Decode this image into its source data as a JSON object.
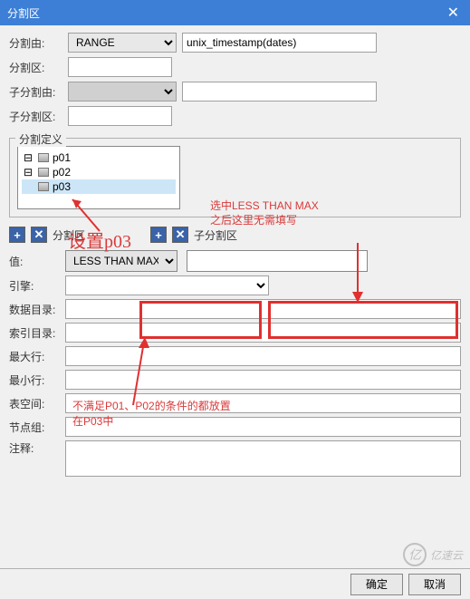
{
  "titlebar": {
    "title": "分割区"
  },
  "form": {
    "partition_by_label": "分割由:",
    "partition_by_value": "RANGE",
    "partition_by_expr": "unix_timestamp(dates)",
    "partition_area_label": "分割区:",
    "partition_area_value": "",
    "sub_partition_by_label": "子分割由:",
    "sub_partition_by_value": "",
    "sub_partition_area_label": "子分割区:",
    "sub_partition_area_value": ""
  },
  "fieldset": {
    "legend": "分割定义",
    "tree": [
      "p01",
      "p02",
      "p03"
    ],
    "selected_index": 2
  },
  "toolbar": {
    "label1": "分割区",
    "label2": "子分割区"
  },
  "lower": {
    "value_label": "值:",
    "value_select": "LESS THAN MAX",
    "value_input": "",
    "engine_label": "引擎:",
    "engine_value": "",
    "data_dir_label": "数据目录:",
    "data_dir_value": "",
    "index_dir_label": "索引目录:",
    "index_dir_value": "",
    "max_row_label": "最大行:",
    "max_row_value": "",
    "min_row_label": "最小行:",
    "min_row_value": "",
    "tablespace_label": "表空间:",
    "tablespace_value": "",
    "nodegroup_label": "节点组:",
    "nodegroup_value": "",
    "comment_label": "注释:",
    "comment_value": ""
  },
  "footer": {
    "ok": "确定",
    "cancel": "取消"
  },
  "annotations": {
    "a1": "设置p03",
    "a2_line1": "选中LESS THAN MAX",
    "a2_line2": "之后这里无需填写",
    "a3_line1": "不满足P01、P02的条件的都放置",
    "a3_line2": "在P03中"
  },
  "watermark": "亿速云"
}
